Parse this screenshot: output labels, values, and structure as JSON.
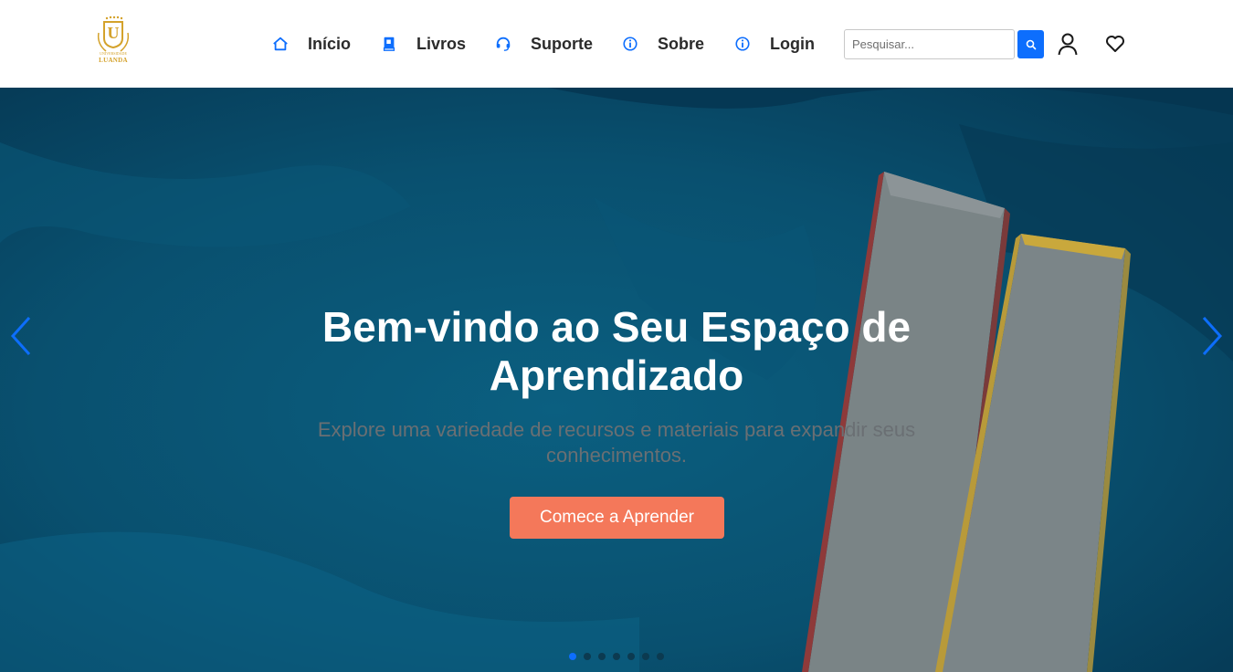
{
  "header": {
    "logo": {
      "name": "LUANDA",
      "subtitle": "UNIVERSIDADE"
    },
    "nav": [
      {
        "label": "Início",
        "icon": "home-icon"
      },
      {
        "label": "Livros",
        "icon": "book-icon"
      },
      {
        "label": "Suporte",
        "icon": "headset-icon"
      },
      {
        "label": "Sobre",
        "icon": "info-icon"
      },
      {
        "label": "Login",
        "icon": "info-icon"
      }
    ],
    "search": {
      "placeholder": "Pesquisar...",
      "value": ""
    }
  },
  "hero": {
    "title": "Bem-vindo ao Seu Espaço de Aprendizado",
    "subtitle": "Explore uma variedade de recursos e materiais para expandir seus conhecimentos.",
    "cta_label": "Comece a Aprender",
    "slides_total": 7,
    "active_slide": 1
  },
  "colors": {
    "accent": "#0d6efd",
    "cta": "#f4785a",
    "hero_bg": "#0a5372",
    "logo_gold": "#d4a22b"
  }
}
